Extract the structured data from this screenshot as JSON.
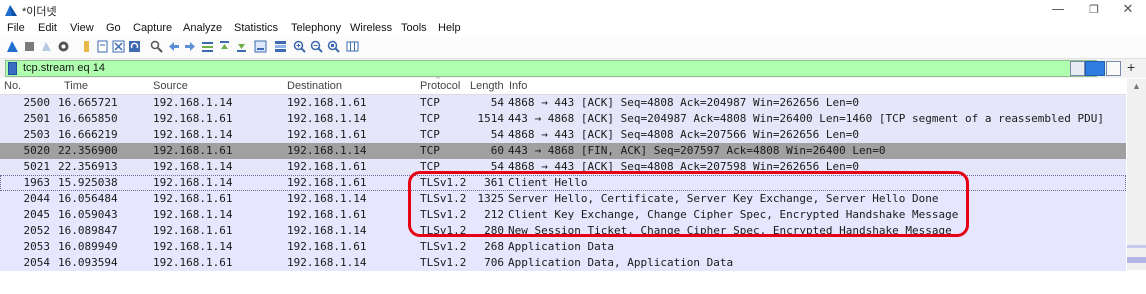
{
  "window": {
    "title": "*이더넷",
    "minimize_glyph": "—",
    "maximize_glyph": "❐",
    "close_glyph": "✕"
  },
  "menu": [
    "File",
    "Edit",
    "View",
    "Go",
    "Capture",
    "Analyze",
    "Statistics",
    "Telephony",
    "Wireless",
    "Tools",
    "Help"
  ],
  "toolbar_icons": [
    "start-capture-icon",
    "stop-capture-icon",
    "restart-capture-icon",
    "capture-options-icon",
    "open-file-icon",
    "save-file-icon",
    "close-file-icon",
    "reload-icon",
    "find-packet-icon",
    "go-back-icon",
    "go-forward-icon",
    "go-to-packet-icon",
    "go-first-icon",
    "go-last-icon",
    "autoscroll-icon",
    "colorize-icon",
    "zoom-in-icon",
    "zoom-out-icon",
    "normal-size-icon",
    "resize-columns-icon"
  ],
  "filter": {
    "value": "tcp.stream eq 14",
    "plus": "+"
  },
  "columns": {
    "no": "No.",
    "time": "Time",
    "source": "Source",
    "destination": "Destination",
    "protocol": "Protocol",
    "length": "Length",
    "info": "Info"
  },
  "packets": [
    {
      "no": "2500",
      "time": "16.665721",
      "src": "192.168.1.14",
      "dst": "192.168.1.61",
      "proto": "TCP",
      "len": "54",
      "info": "4868 → 443 [ACK] Seq=4808 Ack=204987 Win=262656 Len=0"
    },
    {
      "no": "2501",
      "time": "16.665850",
      "src": "192.168.1.61",
      "dst": "192.168.1.14",
      "proto": "TCP",
      "len": "1514",
      "info": "443 → 4868 [ACK] Seq=204987 Ack=4808 Win=26400 Len=1460 [TCP segment of a reassembled PDU]"
    },
    {
      "no": "2503",
      "time": "16.666219",
      "src": "192.168.1.14",
      "dst": "192.168.1.61",
      "proto": "TCP",
      "len": "54",
      "info": "4868 → 443 [ACK] Seq=4808 Ack=207566 Win=262656 Len=0"
    },
    {
      "no": "5020",
      "time": "22.356900",
      "src": "192.168.1.61",
      "dst": "192.168.1.14",
      "proto": "TCP",
      "len": "60",
      "info": "443 → 4868 [FIN, ACK] Seq=207597 Ack=4808 Win=26400 Len=0"
    },
    {
      "no": "5021",
      "time": "22.356913",
      "src": "192.168.1.14",
      "dst": "192.168.1.61",
      "proto": "TCP",
      "len": "54",
      "info": "4868 → 443 [ACK] Seq=4808 Ack=207598 Win=262656 Len=0"
    },
    {
      "no": "1963",
      "time": "15.925038",
      "src": "192.168.1.14",
      "dst": "192.168.1.61",
      "proto": "TLSv1.2",
      "len": "361",
      "info": "Client Hello"
    },
    {
      "no": "2044",
      "time": "16.056484",
      "src": "192.168.1.61",
      "dst": "192.168.1.14",
      "proto": "TLSv1.2",
      "len": "1325",
      "info": "Server Hello, Certificate, Server Key Exchange, Server Hello Done"
    },
    {
      "no": "2045",
      "time": "16.059043",
      "src": "192.168.1.14",
      "dst": "192.168.1.61",
      "proto": "TLSv1.2",
      "len": "212",
      "info": "Client Key Exchange, Change Cipher Spec, Encrypted Handshake Message"
    },
    {
      "no": "2052",
      "time": "16.089847",
      "src": "192.168.1.61",
      "dst": "192.168.1.14",
      "proto": "TLSv1.2",
      "len": "280",
      "info": "New Session Ticket, Change Cipher Spec, Encrypted Handshake Message"
    },
    {
      "no": "2053",
      "time": "16.089949",
      "src": "192.168.1.14",
      "dst": "192.168.1.61",
      "proto": "TLSv1.2",
      "len": "268",
      "info": "Application Data"
    },
    {
      "no": "2054",
      "time": "16.093594",
      "src": "192.168.1.61",
      "dst": "192.168.1.14",
      "proto": "TLSv1.2",
      "len": "706",
      "info": "Application Data, Application Data"
    }
  ],
  "colors": {
    "tcp_row": "#e6e6fb",
    "selected_row": "#a0a0a0",
    "tls_row": "#e7e6ff",
    "filter_valid": "#afffaf",
    "annotation": "#e60014"
  }
}
